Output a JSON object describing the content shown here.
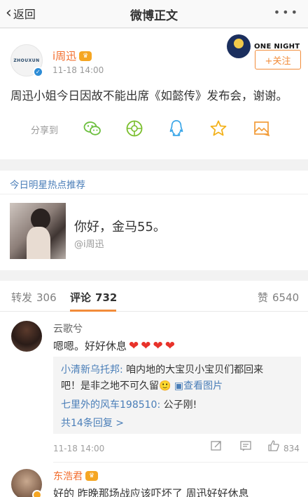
{
  "nav": {
    "back_label": "返回",
    "title": "微博正文",
    "more_label": "•••"
  },
  "post": {
    "avatar_text": "ZHOUXUN",
    "username": "i周迅",
    "time": "11-18 14:00",
    "promo_text": "ONE NIGHT",
    "follow_label": "+关注",
    "text": "周迅小姐今日因故不能出席《如懿传》发布会，谢谢。",
    "share_label": "分享到",
    "share_icons": [
      "wechat-icon",
      "moments-icon",
      "qq-icon",
      "star-icon",
      "image-share-icon"
    ]
  },
  "hot": {
    "title": "今日明星热点推荐",
    "headline": "你好，金马55。",
    "sub": "@i周迅"
  },
  "comments": {
    "tabs": [
      {
        "label": "转发",
        "count": "306"
      },
      {
        "label": "评论",
        "count": "732"
      },
      {
        "label": "赞",
        "count": "6540"
      }
    ],
    "active_tab": "评论",
    "items": [
      {
        "name": "云歌兮",
        "text": "嗯嗯。好好休息",
        "replies": [
          {
            "name": "小清新乌托邦:",
            "text": "咱内地的大宝贝小宝贝们都回来",
            "text2": "吧！是非之地不可久留🙂",
            "link": "▣查看图片"
          },
          {
            "name": "七里外的风车198510:",
            "text": "公子刚!"
          }
        ],
        "more_replies": "共14条回复 >",
        "time": "11-18 14:00",
        "likes": "834"
      },
      {
        "name": "东浩君",
        "text": "好的 昨晚那场战应该吓坏了 周迅好好休息"
      }
    ]
  },
  "colors": {
    "accent": "#f28c3a",
    "link": "#4a7eb8",
    "username": "#f26d2d"
  }
}
